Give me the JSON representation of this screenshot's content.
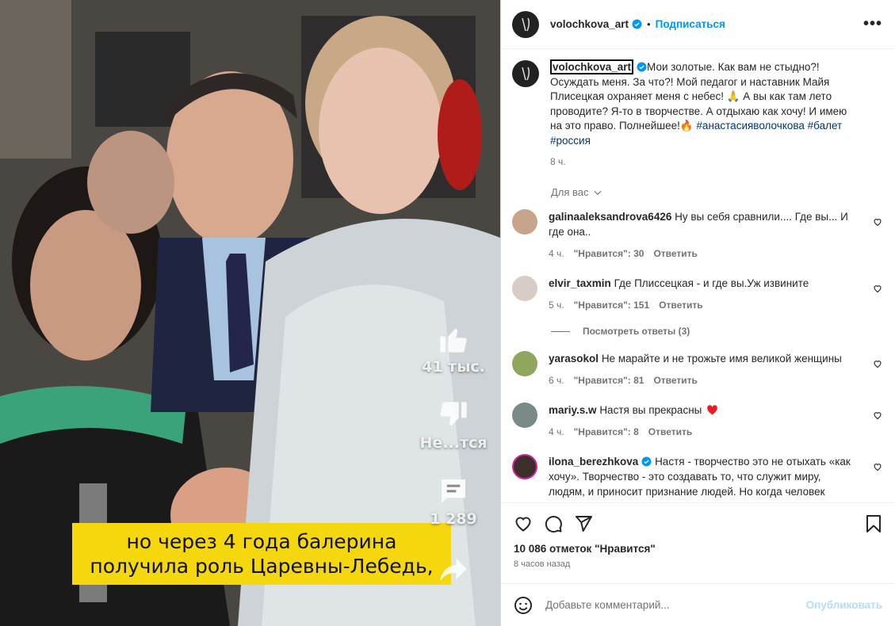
{
  "media": {
    "caption_line1": "но через 4 года балерина",
    "caption_line2": "получила роль Царевны-Лебедь,",
    "likes_label": "41 тыс.",
    "dislike_label": "Не...тся",
    "comments_label": "1 289",
    "colors": {
      "banner": "#f4d70d"
    }
  },
  "header": {
    "username": "volochkova_art",
    "dot": "•",
    "follow_label": "Подписаться",
    "more_label": "•••"
  },
  "caption": {
    "username": "volochkova_art",
    "text": "Мои золотые. Как вам не стыдно?! Осуждать меня. За что?! Мой педагог и наставник Майя Плисецкая охраняет меня с небес! 🙏 А вы как там лето проводите? Я-то в творчестве. А отдыхаю как хочу! И имею на это право. Полнейшее!🔥",
    "tags": [
      "#анастасияволочкова",
      "#балет",
      "#россия"
    ],
    "time": "8 ч."
  },
  "for_you_label": "Для вас",
  "comments": [
    {
      "username": "galinaaleksandrova6426",
      "text": "Ну вы себя сравнили.... Где вы... И где она..",
      "time": "4 ч.",
      "likes": "\"Нравится\": 30",
      "reply": "Ответить"
    },
    {
      "username": "elvir_taxmin",
      "text": "Где Плиссецкая - и где вы.Уж извините",
      "time": "5 ч.",
      "likes": "\"Нравится\": 151",
      "reply": "Ответить"
    },
    {
      "username": "yarasokol",
      "text": "Не марайте и не трожьте имя великой женщины",
      "time": "6 ч.",
      "likes": "\"Нравится\": 81",
      "reply": "Ответить"
    },
    {
      "username": "mariy.s.w",
      "text": "Настя вы прекрасны",
      "time": "4 ч.",
      "likes": "\"Нравится\": 8",
      "reply": "Ответить"
    },
    {
      "username": "ilona_berezhkova",
      "text": "Настя - творчество это не отыхать «как хочу». Творчество - это создавать то, что служит миру, людям, и приносит признание людей. Но когда человек"
    }
  ],
  "view_replies": "Посмотреть ответы (3)",
  "footer": {
    "likes_count": "10 086 отметок \"Нравится\"",
    "time": "8 часов назад",
    "comment_placeholder": "Добавьте комментарий...",
    "publish_label": "Опубликовать"
  },
  "colors": {
    "accent": "#0095f6",
    "verified": "#0095f6",
    "heart_red": "#ed4956"
  }
}
